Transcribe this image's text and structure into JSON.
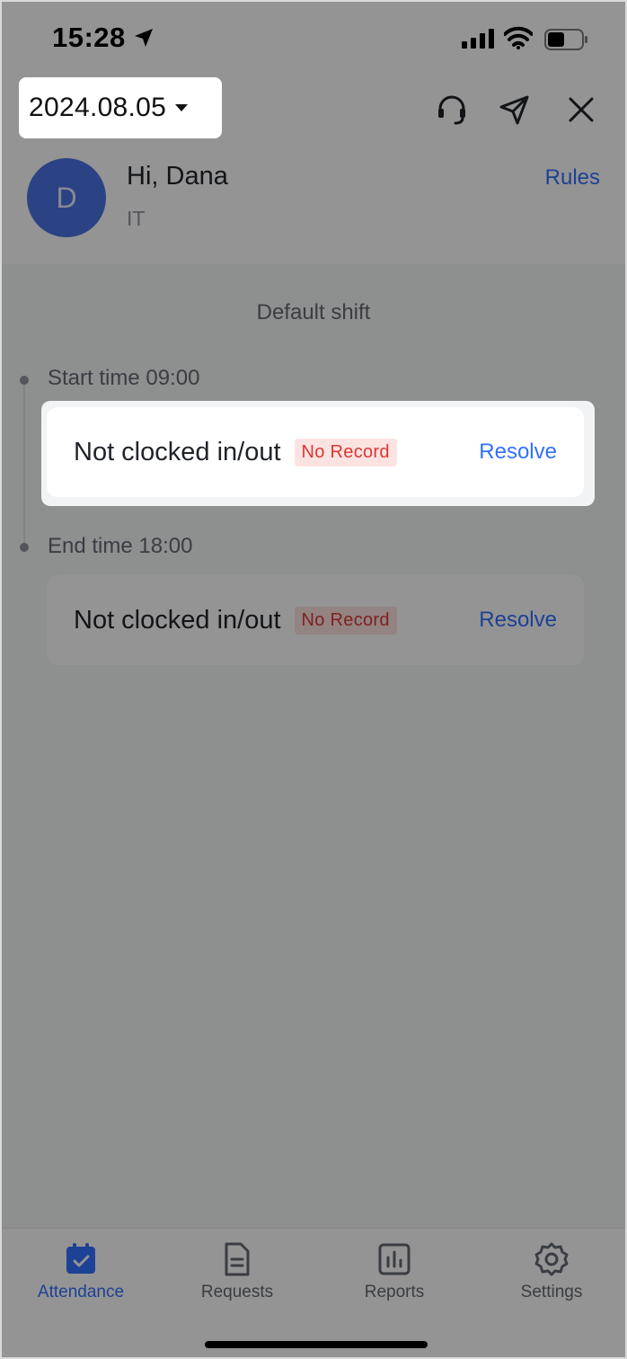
{
  "status_bar": {
    "time": "15:28"
  },
  "header": {
    "date": "2024.08.05",
    "user_initial": "D",
    "greeting": "Hi, Dana",
    "department": "IT",
    "rules_label": "Rules"
  },
  "shift": {
    "title": "Default shift",
    "entries": [
      {
        "time_label": "Start time 09:00",
        "status": "Not clocked in/out",
        "badge": "No Record",
        "action": "Resolve"
      },
      {
        "time_label": "End time 18:00",
        "status": "Not clocked in/out",
        "badge": "No Record",
        "action": "Resolve"
      }
    ]
  },
  "tabs": [
    {
      "label": "Attendance",
      "icon": "calendar-check-icon",
      "active": true
    },
    {
      "label": "Requests",
      "icon": "document-icon",
      "active": false
    },
    {
      "label": "Reports",
      "icon": "bar-chart-icon",
      "active": false
    },
    {
      "label": "Settings",
      "icon": "gear-icon",
      "active": false
    }
  ],
  "colors": {
    "accent": "#3370ff",
    "badge_text": "#d83931",
    "badge_bg": "#fde2e2",
    "overlay": "rgba(0,0,0,0.42)"
  }
}
